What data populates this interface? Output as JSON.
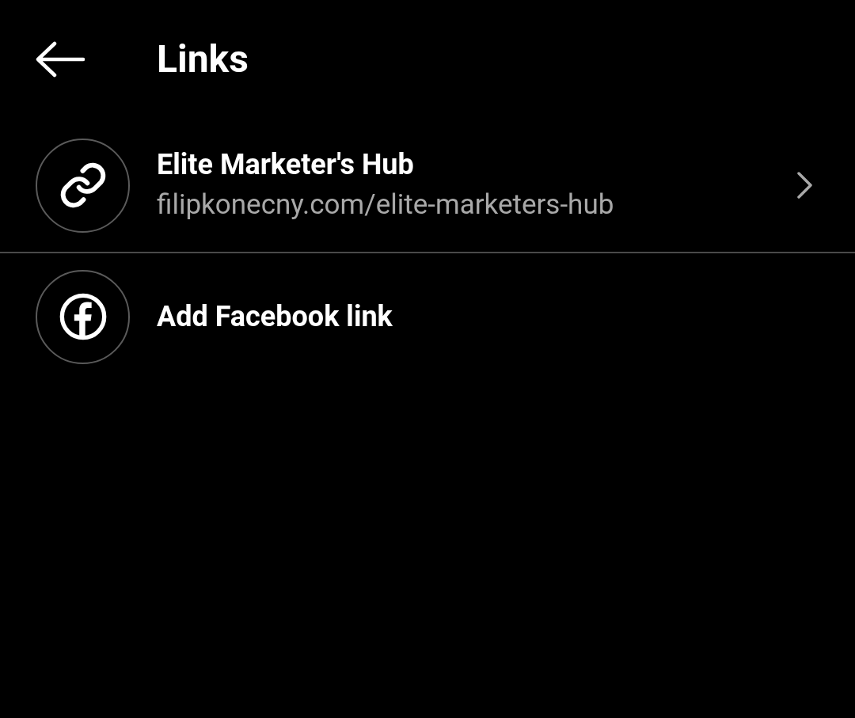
{
  "header": {
    "title": "Links"
  },
  "items": [
    {
      "kind": "link",
      "title": "Elite Marketer's Hub",
      "subtitle": "filipkonecny.com/elite-marketers-hub"
    },
    {
      "kind": "facebook",
      "title": "Add Facebook link"
    }
  ]
}
